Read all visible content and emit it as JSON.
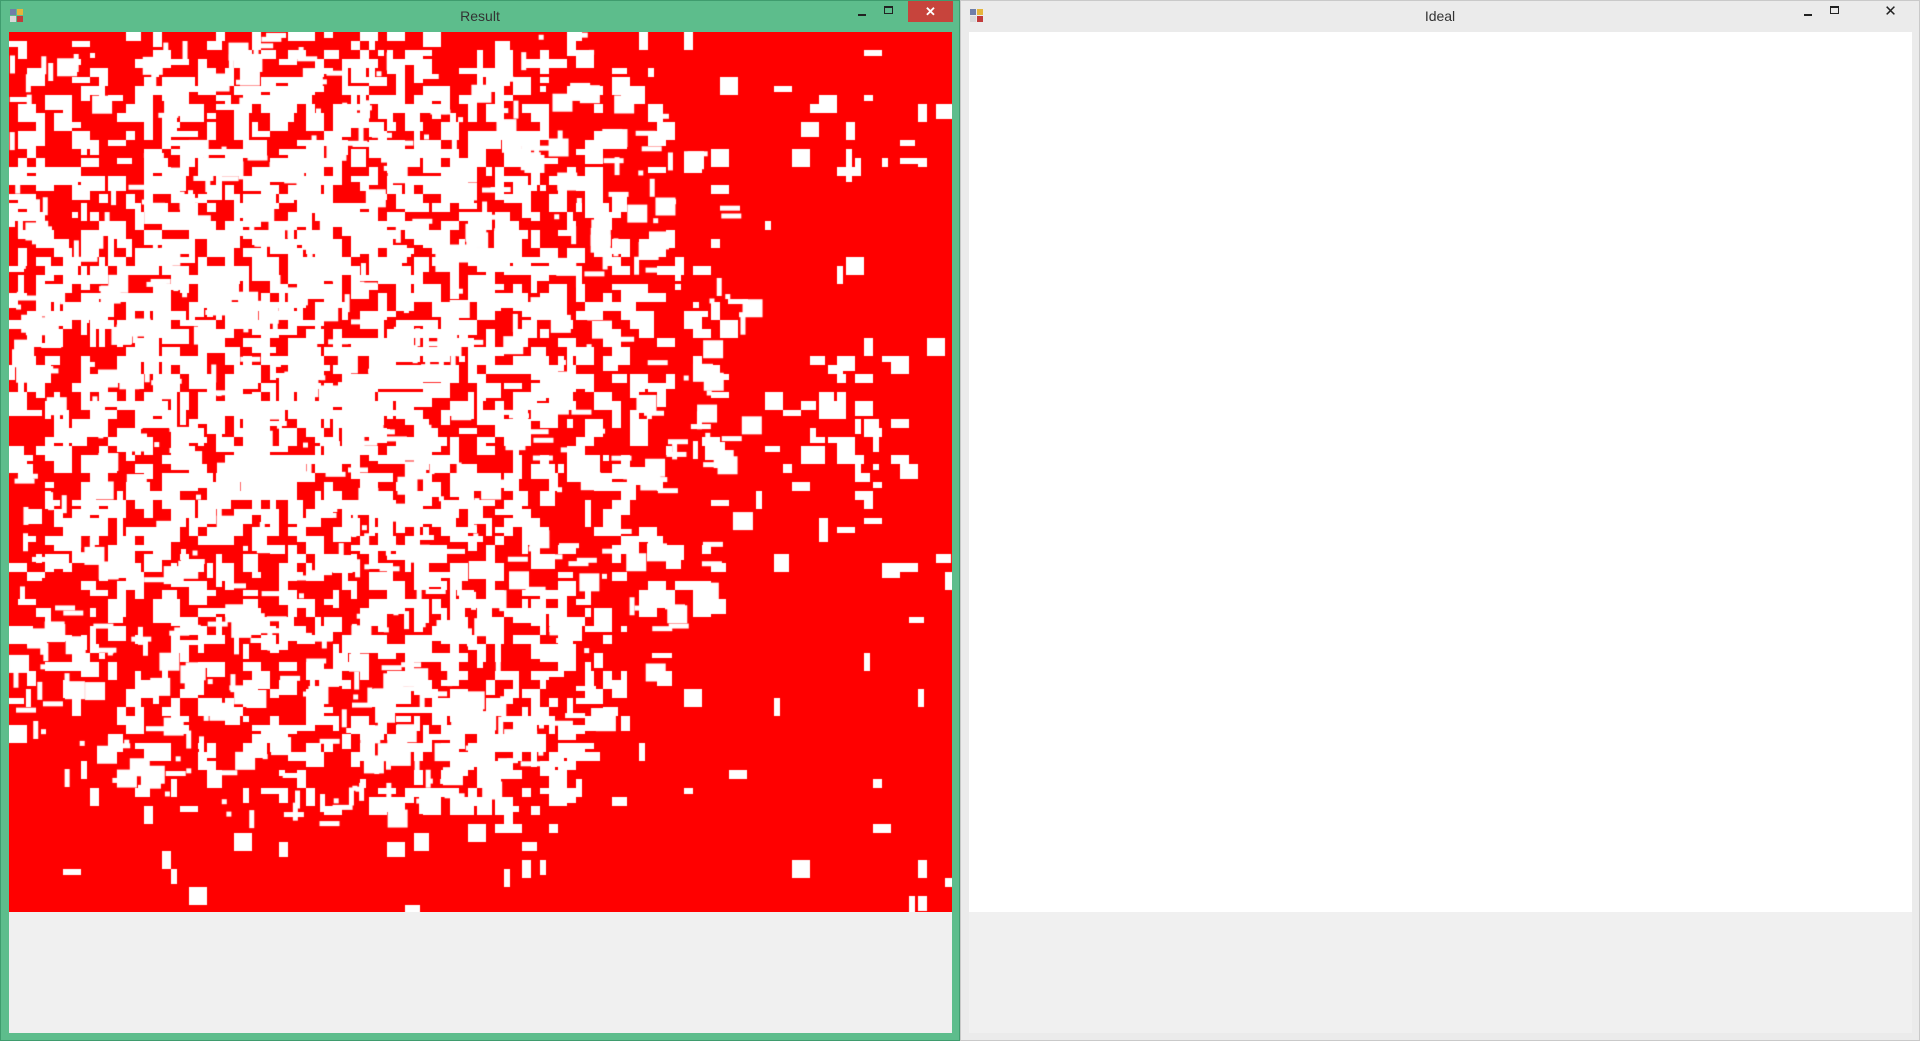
{
  "windows": {
    "result": {
      "title": "Result",
      "controls": {
        "minimize": "minimize-icon",
        "maximize": "maximize-icon",
        "close": "close-icon"
      },
      "picture": {
        "fill_color": "#ff0000",
        "background_color": "#ffffff"
      }
    },
    "ideal": {
      "title": "Ideal",
      "controls": {
        "minimize": "minimize-icon",
        "maximize": "maximize-icon",
        "close": "close-icon"
      },
      "picture": {
        "background_color": "#ffffff"
      }
    }
  },
  "colors": {
    "active_frame": "#5dbd8c",
    "inactive_frame": "#ebebeb",
    "close_button": "#c7443c",
    "client_background": "#f0f0f0"
  }
}
